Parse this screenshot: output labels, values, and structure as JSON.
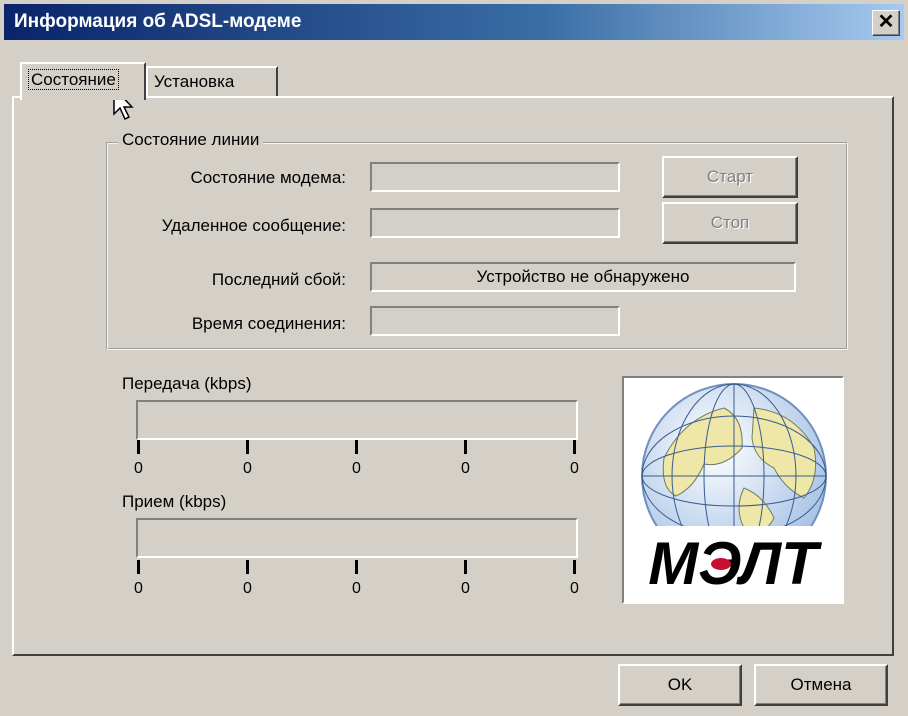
{
  "window": {
    "title": "Информация об ADSL-модеме",
    "close_symbol": "✕"
  },
  "tabs": [
    {
      "label": "Состояние",
      "active": true
    },
    {
      "label": "Установка",
      "active": false
    }
  ],
  "line_status": {
    "group_title": "Состояние линии",
    "modem_state_label": "Состояние модема:",
    "modem_state_value": "",
    "remote_message_label": "Удаленное сообщение:",
    "remote_message_value": "",
    "last_failure_label": "Последний сбой:",
    "last_failure_value": "Устройство не обнаружено",
    "connection_time_label": "Время соединения:",
    "connection_time_value": "",
    "start_button": "Старт",
    "stop_button": "Стоп"
  },
  "transmit": {
    "label": "Передача (kbps)",
    "value": 0,
    "ticks": [
      "0",
      "0",
      "0",
      "0",
      "0"
    ]
  },
  "receive": {
    "label": "Прием (kbps)",
    "value": 0,
    "ticks": [
      "0",
      "0",
      "0",
      "0",
      "0"
    ]
  },
  "logo": {
    "text": "МЭЛТ"
  },
  "footer": {
    "ok_button": "OK",
    "cancel_button": "Отмена"
  },
  "colors": {
    "title_start": "#0a246a",
    "title_end": "#a6caf0",
    "face": "#d4d0c8",
    "logo_red": "#c8102e"
  }
}
